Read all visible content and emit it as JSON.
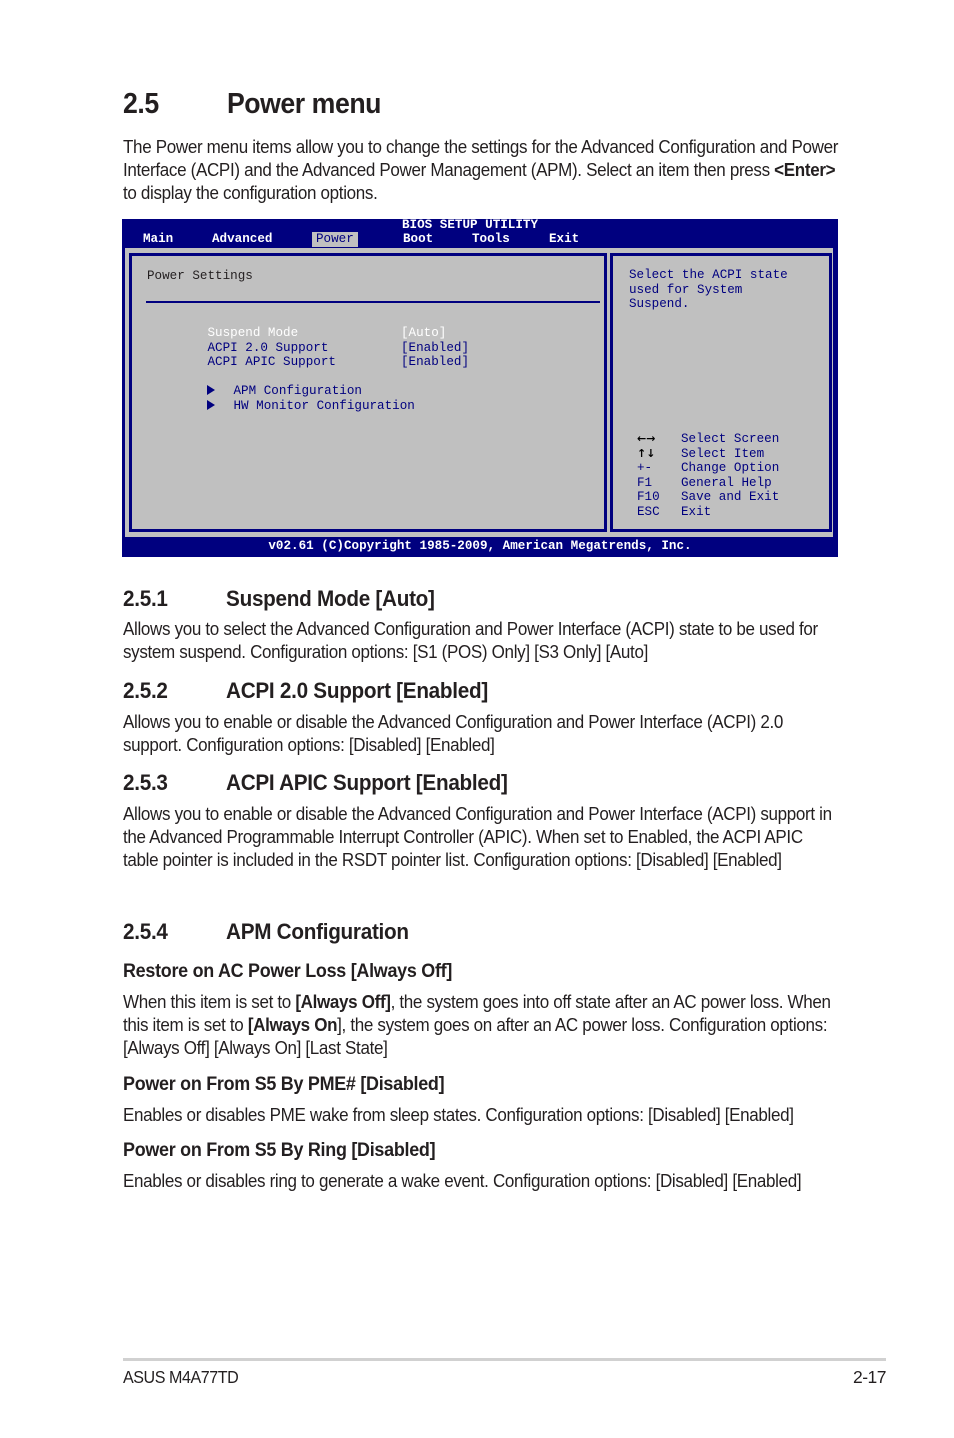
{
  "section": {
    "number": "2.5",
    "title": "Power menu",
    "intro_before": "The Power menu items allow you to change the settings for the Advanced Configuration and Power Interface (ACPI) and the Advanced Power Management (APM). Select an item then press ",
    "intro_bold": "<Enter>",
    "intro_after": " to display the configuration options."
  },
  "bios": {
    "title": "BIOS SETUP UTILITY",
    "menu": [
      {
        "label": "Main",
        "active": false
      },
      {
        "label": "Advanced",
        "active": false
      },
      {
        "label": "Power",
        "active": true
      },
      {
        "label": "Boot",
        "active": false
      },
      {
        "label": "Tools",
        "active": false
      },
      {
        "label": "Exit",
        "active": false
      }
    ],
    "panel_heading": "Power Settings",
    "settings": [
      {
        "label": "Suspend Mode",
        "value": "[Auto]",
        "selected": true
      },
      {
        "label": "ACPI 2.0 Support",
        "value": "[Enabled]",
        "selected": false
      },
      {
        "label": "ACPI APIC Support",
        "value": "[Enabled]",
        "selected": false
      }
    ],
    "submenus": [
      {
        "label": "APM Configuration"
      },
      {
        "label": "HW Monitor Configuration"
      }
    ],
    "help_text": "Select the ACPI state\nused for System\nSuspend.",
    "keys": [
      {
        "key": "←→",
        "action": "Select Screen",
        "icon": "left-right-arrows-icon"
      },
      {
        "key": "↑↓",
        "action": "Select Item",
        "icon": "up-down-arrows-icon"
      },
      {
        "key": "+-",
        "action": "Change Option"
      },
      {
        "key": "F1",
        "action": "General Help"
      },
      {
        "key": "F10",
        "action": "Save and Exit"
      },
      {
        "key": "ESC",
        "action": "Exit"
      }
    ],
    "footer": "v02.61 (C)Copyright 1985-2009, American Megatrends, Inc.",
    "colors": {
      "background": "#00007f",
      "panel": "#c0c0c0",
      "highlight_text": "#ffffff"
    }
  },
  "subsections": [
    {
      "number": "2.5.1",
      "title": "Suspend Mode [Auto]",
      "body": "Allows you to select the Advanced Configuration and Power Interface (ACPI) state to be used for system suspend. Configuration options: [S1 (POS) Only] [S3 Only] [Auto]"
    },
    {
      "number": "2.5.2",
      "title": "ACPI 2.0 Support [Enabled]",
      "body": "Allows you to enable or disable the Advanced Configuration and Power Interface (ACPI) 2.0 support. Configuration options: [Disabled] [Enabled]"
    },
    {
      "number": "2.5.3",
      "title": "ACPI APIC Support [Enabled]",
      "body": "Allows you to enable or disable the Advanced Configuration and Power Interface (ACPI) support in the Advanced Programmable Interrupt Controller (APIC). When set to Enabled, the ACPI APIC table pointer is included in the RSDT pointer list. Configuration options: [Disabled] [Enabled]"
    },
    {
      "number": "2.5.4",
      "title": "APM Configuration"
    }
  ],
  "apm_items": [
    {
      "title": "Restore on AC Power Loss [Always Off]",
      "body_parts": [
        {
          "text": "When this item is set to ",
          "bold": false
        },
        {
          "text": "[Always Off]",
          "bold": true
        },
        {
          "text": ", the system goes into off state after an AC power loss. When this item is set to ",
          "bold": false
        },
        {
          "text": "[Always On",
          "bold": true
        },
        {
          "text": "], the system goes on after an AC power loss. Configuration options: [Always Off] [Always On] [Last State]",
          "bold": false
        }
      ]
    },
    {
      "title": "Power on From S5 By PME# [Disabled]",
      "body_parts": [
        {
          "text": "Enables or disables PME wake from sleep states. Configuration options: [Disabled] [Enabled]",
          "bold": false
        }
      ]
    },
    {
      "title": "Power on From S5 By Ring [Disabled]",
      "body_parts": [
        {
          "text": "Enables or disables ring to generate a wake event. Configuration options: [Disabled] [Enabled]",
          "bold": false
        }
      ]
    }
  ],
  "footer": {
    "product": "ASUS M4A77TD",
    "page": "2-17"
  }
}
